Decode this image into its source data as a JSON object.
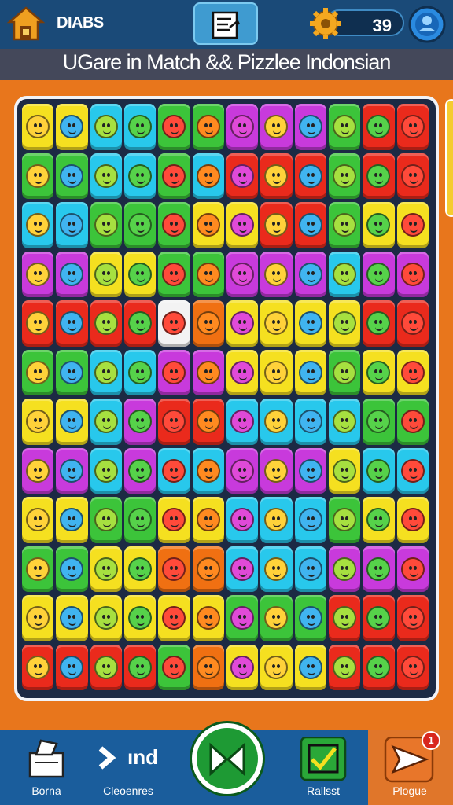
{
  "header": {
    "brand": "DIABS",
    "coins": "39",
    "title": "UGare in Match && Pizzlee Indonsian"
  },
  "bottom_nav": [
    {
      "label": "Borna",
      "icon": "ballot-box-icon"
    },
    {
      "label": "Cleoenres",
      "icon": "arrow-right-icon"
    },
    {
      "label": "",
      "icon": "play-icon"
    },
    {
      "label": "Rallsst",
      "icon": "checkbox-icon"
    },
    {
      "label": "Plogue",
      "icon": "send-icon"
    }
  ],
  "nav_extra": {
    "cleoenres_glyph": "ınd",
    "notification_badge": "1"
  },
  "board": {
    "colors": {
      "yellow": "#f5e020",
      "cyan": "#28c8ec",
      "green": "#3cc43a",
      "magenta": "#c83adc",
      "red": "#ea2a1c",
      "orange": "#f07012",
      "white": "#f3f3f3"
    }
  }
}
